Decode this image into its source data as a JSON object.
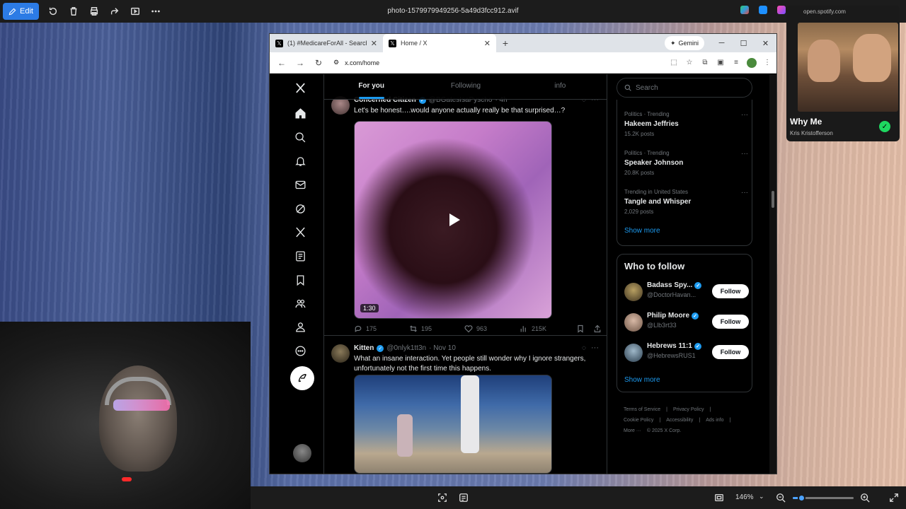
{
  "viewer": {
    "edit_label": "Edit",
    "file_title": "photo-1579979949256-5a49d3fcc912.avif",
    "zoom_level": "146%",
    "zoom_fraction": 0.14,
    "top_icons": [
      "rotate-icon",
      "delete-icon",
      "print-icon",
      "share-icon",
      "slideshow-icon",
      "more-icon"
    ],
    "bottom_icons": [
      "fit-icon",
      "ocr-icon",
      "aspect-icon",
      "zoom-out-icon",
      "zoom-in-icon",
      "fullscreen-icon"
    ]
  },
  "browser": {
    "tabs": [
      {
        "label": "(1) #MedicareForAll - Search / X",
        "active": false
      },
      {
        "label": "Home / X",
        "active": true
      }
    ],
    "gemini_label": "Gemini",
    "url": "x.com/home"
  },
  "feed": {
    "tabs": [
      {
        "label": "For you",
        "active": true
      },
      {
        "label": "Following",
        "active": false
      },
      {
        "label": "info",
        "active": false
      }
    ],
    "tweets": [
      {
        "name": "Concerned Citizen",
        "handle": "@BGatesIsaPyscho",
        "time": "· 4h",
        "text": "Let's be honest….would anyone actually really be that surprised…?",
        "video_duration": "1:30",
        "replies": "175",
        "reposts": "195",
        "likes": "963",
        "views": "215K"
      },
      {
        "name": "Kitten",
        "handle": "@0nlyk1tt3n",
        "time": "· Nov 10",
        "text": "What an insane interaction. Yet people still wonder why I ignore strangers, unfortunately not the first time this happens."
      }
    ]
  },
  "sidebar": {
    "search_placeholder": "Search",
    "trends": [
      {
        "category": "Politics · Trending",
        "name": "Hakeem Jeffries",
        "posts": "15.2K posts"
      },
      {
        "category": "Politics · Trending",
        "name": "Speaker Johnson",
        "posts": "20.8K posts"
      },
      {
        "category": "Trending in United States",
        "name": "Tangle and Whisper",
        "posts": "2,029 posts"
      }
    ],
    "show_more": "Show more",
    "who_to_follow_title": "Who to follow",
    "follow_suggestions": [
      {
        "name": "Badass Spy...",
        "handle": "@DoctorHavan...",
        "button": "Follow"
      },
      {
        "name": "Philip Moore",
        "handle": "@Llb3rt33",
        "button": "Follow"
      },
      {
        "name": "Hebrews 11:1",
        "handle": "@HebrewsRUS1",
        "button": "Follow"
      }
    ],
    "footer": [
      "Terms of Service",
      "|",
      "Privacy Policy",
      "|",
      "Cookie Policy",
      "|",
      "Accessibility",
      "|",
      "Ads info",
      "|",
      "More ···",
      "© 2025 X Corp."
    ]
  },
  "spotify": {
    "url": "open.spotify.com",
    "song": "Why Me",
    "artist": "Kris Kristofferson"
  },
  "colors": {
    "accent": "#1d9bf0",
    "edit_button": "#2c7be5",
    "spotify_green": "#1ed760"
  }
}
